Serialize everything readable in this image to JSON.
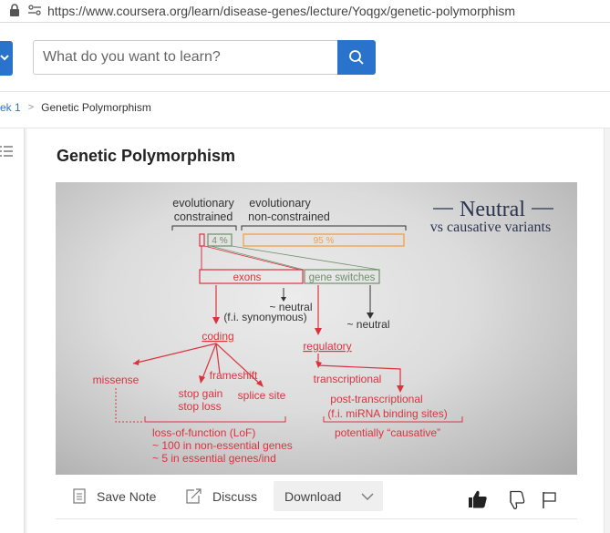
{
  "browser": {
    "url": "https://www.coursera.org/learn/disease-genes/lecture/Yoqgx/genetic-polymorphism"
  },
  "search": {
    "placeholder": "What do you want to learn?"
  },
  "breadcrumb": {
    "week": "ek 1",
    "separator": ">",
    "current": "Genetic Polymorphism"
  },
  "lecture": {
    "title": "Genetic Polymorphism"
  },
  "slide": {
    "title_main": "Neutral",
    "title_sub": "vs causative variants",
    "label_evo_constrained_1": "evolutionary",
    "label_evo_constrained_2": "constrained",
    "label_evo_nonconstrained_1": "evolutionary",
    "label_evo_nonconstrained_2": "non-constrained",
    "pct_4": "4 %",
    "pct_95": "95 %",
    "exons": "exons",
    "gene_switches": "gene switches",
    "neutral_fi_1": "~ neutral",
    "neutral_fi_2": "(f.i. synonymous)",
    "neutral_right": "~ neutral",
    "coding": "coding",
    "regulatory": "regulatory",
    "missense": "missense",
    "frameshift": "frameshift",
    "stop_gain": "stop gain",
    "stop_loss": "stop loss",
    "splice_site": "splice site",
    "transcriptional": "transcriptional",
    "post_transcriptional": "post-transcriptional",
    "mirna": "(f.i. miRNA binding sites)",
    "causative": "potentially “causative”",
    "lof_1": "loss-of-function (LoF)",
    "lof_2": "~ 100 in non-essential genes",
    "lof_3": "~ 5 in essential genes/ind"
  },
  "toolbar": {
    "save_note": "Save Note",
    "discuss": "Discuss",
    "download": "Download"
  },
  "colors": {
    "accent_blue": "#2a73cc",
    "slide_red": "#d9333f",
    "slide_green": "#6f8f6c",
    "slide_orange": "#f0a04b",
    "slide_title": "#2b3550"
  },
  "icons": [
    "lock-icon",
    "site-settings-icon",
    "chevron-down-icon",
    "search-icon",
    "list-icon",
    "note-icon",
    "discuss-icon",
    "thumbs-up-icon",
    "thumbs-down-icon",
    "flag-icon"
  ]
}
